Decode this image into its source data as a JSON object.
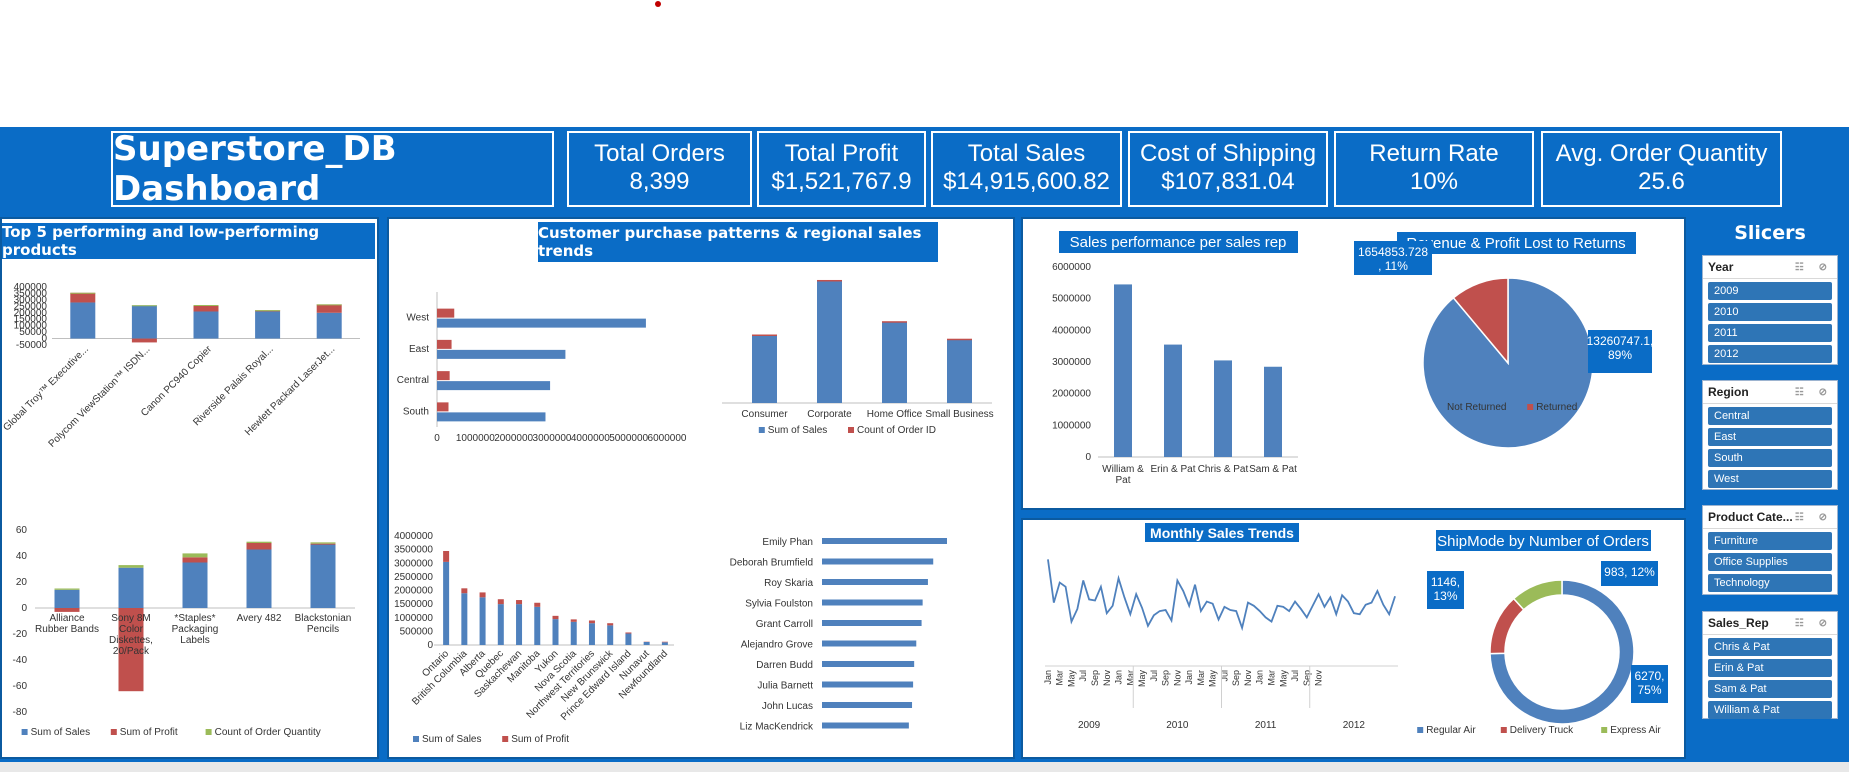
{
  "dashboard_title": "Superstore_DB Dashboard",
  "kpis": [
    {
      "label": "Total Orders",
      "value": "8,399"
    },
    {
      "label": "Total Profit",
      "value": "$1,521,767.9"
    },
    {
      "label": "Total Sales",
      "value": "$14,915,600.82"
    },
    {
      "label": "Cost of Shipping",
      "value": "$107,831.04"
    },
    {
      "label": "Return Rate",
      "value": "10%"
    },
    {
      "label": "Avg. Order Quantity",
      "value": "25.6"
    }
  ],
  "panel_titles": {
    "products": "Top 5 performing and low-performing products",
    "customers": "Customer purchase patterns & regional sales trends",
    "slicers": "Slicers"
  },
  "colors": {
    "blue": "#4f81bd",
    "red": "#c0504d",
    "green": "#9bbb59",
    "brand": "#0a6cc6"
  },
  "slicers": [
    {
      "title": "Year",
      "items": [
        "2009",
        "2010",
        "2011",
        "2012"
      ]
    },
    {
      "title": "Region",
      "items": [
        "Central",
        "East",
        "South",
        "West"
      ]
    },
    {
      "title": "Product Cate...",
      "items": [
        "Furniture",
        "Office Supplies",
        "Technology"
      ]
    },
    {
      "title": "Sales_Rep",
      "items": [
        "Chris & Pat",
        "Erin & Pat",
        "Sam & Pat",
        "William & Pat"
      ]
    }
  ],
  "chart_data": [
    {
      "id": "top5",
      "type": "bar",
      "stacked": true,
      "categories": [
        "Global Troy™ Executive...",
        "Polycom ViewStation™ ISDN...",
        "Canon PC940 Copier",
        "Riverside Palais Royal...",
        "Hewlett Packard LaserJet..."
      ],
      "series": [
        {
          "name": "Sum of Sales",
          "values": [
            280000,
            258000,
            210000,
            210000,
            200000
          ]
        },
        {
          "name": "Sum of Profit",
          "values": [
            75000,
            -30000,
            50000,
            10000,
            65000
          ]
        },
        {
          "name": "Count of Order Quantity",
          "values": [
            300,
            500,
            300,
            300,
            300
          ]
        }
      ],
      "ylim": [
        -50000,
        400000
      ],
      "yticks": [
        "400000",
        "350000",
        "300000",
        "250000",
        "200000",
        "150000",
        "100000",
        "50000",
        "0",
        "-50000"
      ]
    },
    {
      "id": "bottom5",
      "type": "bar",
      "stacked": true,
      "categories": [
        [
          "Alliance",
          "Rubber Bands"
        ],
        [
          "Sony 8M",
          "Color",
          "Diskettes,",
          "20/Pack"
        ],
        [
          "*Staples*",
          "Packaging",
          "Labels"
        ],
        [
          "Avery 482"
        ],
        [
          "Blackstonian",
          "Pencils"
        ]
      ],
      "series": [
        {
          "name": "Sum of Sales",
          "values": [
            14,
            31,
            35,
            45,
            49
          ]
        },
        {
          "name": "Sum of Profit",
          "values": [
            -3,
            -64,
            4,
            5,
            0.5
          ]
        },
        {
          "name": "Count of Order Quantity",
          "values": [
            1,
            2,
            3,
            1,
            1
          ]
        }
      ],
      "ylim": [
        -80,
        60
      ],
      "yticks": [
        "60",
        "40",
        "20",
        "0",
        "-20",
        "-40",
        "-60",
        "-80"
      ],
      "legend": [
        "Sum of Sales",
        "Sum of Profit",
        "Count of Order Quantity"
      ]
    },
    {
      "id": "region",
      "type": "bar",
      "orientation": "horizontal",
      "categories": [
        "West",
        "East",
        "Central",
        "South"
      ],
      "series": [
        {
          "name": "Sum of Sales",
          "values": [
            5450000,
            3350000,
            2950000,
            2830000
          ]
        },
        {
          "name": "Count of Order ID",
          "values": [
            450000,
            380000,
            330000,
            300000
          ]
        }
      ],
      "xlim": [
        0,
        6000000
      ],
      "xticks": [
        "0",
        "1000000",
        "2000000",
        "3000000",
        "4000000",
        "5000000",
        "6000000"
      ]
    },
    {
      "id": "segment",
      "type": "bar",
      "categories": [
        "Consumer",
        "Corporate",
        "Home Office",
        "Small Business"
      ],
      "series": [
        {
          "name": "Sum of Sales",
          "values": [
            3060000,
            5500000,
            3650000,
            2870000
          ]
        },
        {
          "name": "Count of Order ID",
          "values": [
            30000,
            50000,
            40000,
            30000
          ]
        }
      ],
      "ylim": [
        0,
        6000000
      ],
      "legend": [
        "Sum of Sales",
        "Count of Order ID"
      ]
    },
    {
      "id": "province",
      "type": "bar",
      "stacked": true,
      "categories": [
        "Ontario",
        "British Columbia",
        "Alberta",
        "Quebec",
        "Saskachewan",
        "Manitoba",
        "Yukon",
        "Nova Scotia",
        "Northwest Territories",
        "New Brunswick",
        "Prince Edward Island",
        "Nunavut",
        "Newfoundland"
      ],
      "series": [
        {
          "name": "Sum of Sales",
          "values": [
            3050000,
            1900000,
            1750000,
            1500000,
            1500000,
            1400000,
            950000,
            850000,
            800000,
            720000,
            420000,
            110000,
            100000
          ]
        },
        {
          "name": "Sum of Profit",
          "values": [
            400000,
            180000,
            180000,
            180000,
            150000,
            150000,
            120000,
            90000,
            100000,
            80000,
            40000,
            10000,
            20000
          ]
        }
      ],
      "ylim": [
        0,
        4000000
      ],
      "yticks": [
        "4000000",
        "3500000",
        "3000000",
        "2500000",
        "2000000",
        "1500000",
        "1000000",
        "500000",
        "0"
      ],
      "legend": [
        "Sum of Sales",
        "Sum of Profit"
      ]
    },
    {
      "id": "customers",
      "type": "bar",
      "orientation": "horizontal",
      "categories": [
        "Emily Phan",
        "Deborah Brumfield",
        "Roy Skaria",
        "Sylvia Foulston",
        "Grant Carroll",
        "Alejandro Grove",
        "Darren Budd",
        "Julia Barnett",
        "John Lucas",
        "Liz MacKendrick"
      ],
      "values": [
        118000,
        105000,
        100000,
        95000,
        94000,
        89000,
        87000,
        86000,
        85000,
        82000
      ]
    },
    {
      "id": "salesrep",
      "type": "bar",
      "title": "Sales performance per sales rep",
      "categories": [
        [
          "William &",
          "Pat"
        ],
        [
          "Erin & Pat"
        ],
        [
          "Chris & Pat"
        ],
        [
          "Sam & Pat"
        ]
      ],
      "values": [
        5450000,
        3550000,
        3050000,
        2850000
      ],
      "ylim": [
        0,
        6000000
      ],
      "yticks": [
        "6000000",
        "5000000",
        "4000000",
        "3000000",
        "2000000",
        "1000000",
        "0"
      ]
    },
    {
      "id": "returns",
      "type": "pie",
      "title": "Revenue & Profit Lost to Returns",
      "slices": [
        {
          "name": "Not Returned",
          "value": 13260747.1,
          "label": [
            "13260747.1,",
            "89%"
          ]
        },
        {
          "name": "Returned",
          "value": 1654853.728,
          "label": [
            "1654853.728",
            ", 11%"
          ]
        }
      ],
      "legend": [
        "Not Returned",
        "Returned"
      ]
    },
    {
      "id": "monthly",
      "type": "line",
      "title": "Monthly Sales Trends",
      "x_month_labels": [
        "Jan",
        "Mar",
        "May",
        "Jul",
        "Sep",
        "Nov"
      ],
      "x_years": [
        "2009",
        "2010",
        "2011",
        "2012"
      ],
      "values": [
        420000,
        215000,
        310000,
        290000,
        125000,
        185000,
        320000,
        230000,
        225000,
        290000,
        165000,
        200000,
        330000,
        240000,
        160000,
        255000,
        190000,
        105000,
        155000,
        175000,
        180000,
        130000,
        320000,
        270000,
        200000,
        300000,
        175000,
        220000,
        210000,
        135000,
        195000,
        180000,
        175000,
        95000,
        215000,
        200000,
        175000,
        145000,
        125000,
        200000,
        195000,
        175000,
        220000,
        185000,
        145000,
        200000,
        255000,
        195000,
        240000,
        160000,
        250000,
        220000,
        165000,
        160000,
        205000,
        215000,
        270000,
        205000,
        160000,
        245000
      ]
    },
    {
      "id": "shipmode",
      "type": "pie",
      "donut": true,
      "title": "ShipMode by Number of Orders",
      "slices": [
        {
          "name": "Regular Air",
          "value": 6270,
          "label": [
            "6270,",
            "75%"
          ]
        },
        {
          "name": "Delivery Truck",
          "value": 1146,
          "label": [
            "1146,",
            "13%"
          ]
        },
        {
          "name": "Express Air",
          "value": 983,
          "label": [
            "983, 12%"
          ]
        }
      ],
      "legend": [
        "Regular Air",
        "Delivery Truck",
        "Express Air"
      ]
    }
  ]
}
